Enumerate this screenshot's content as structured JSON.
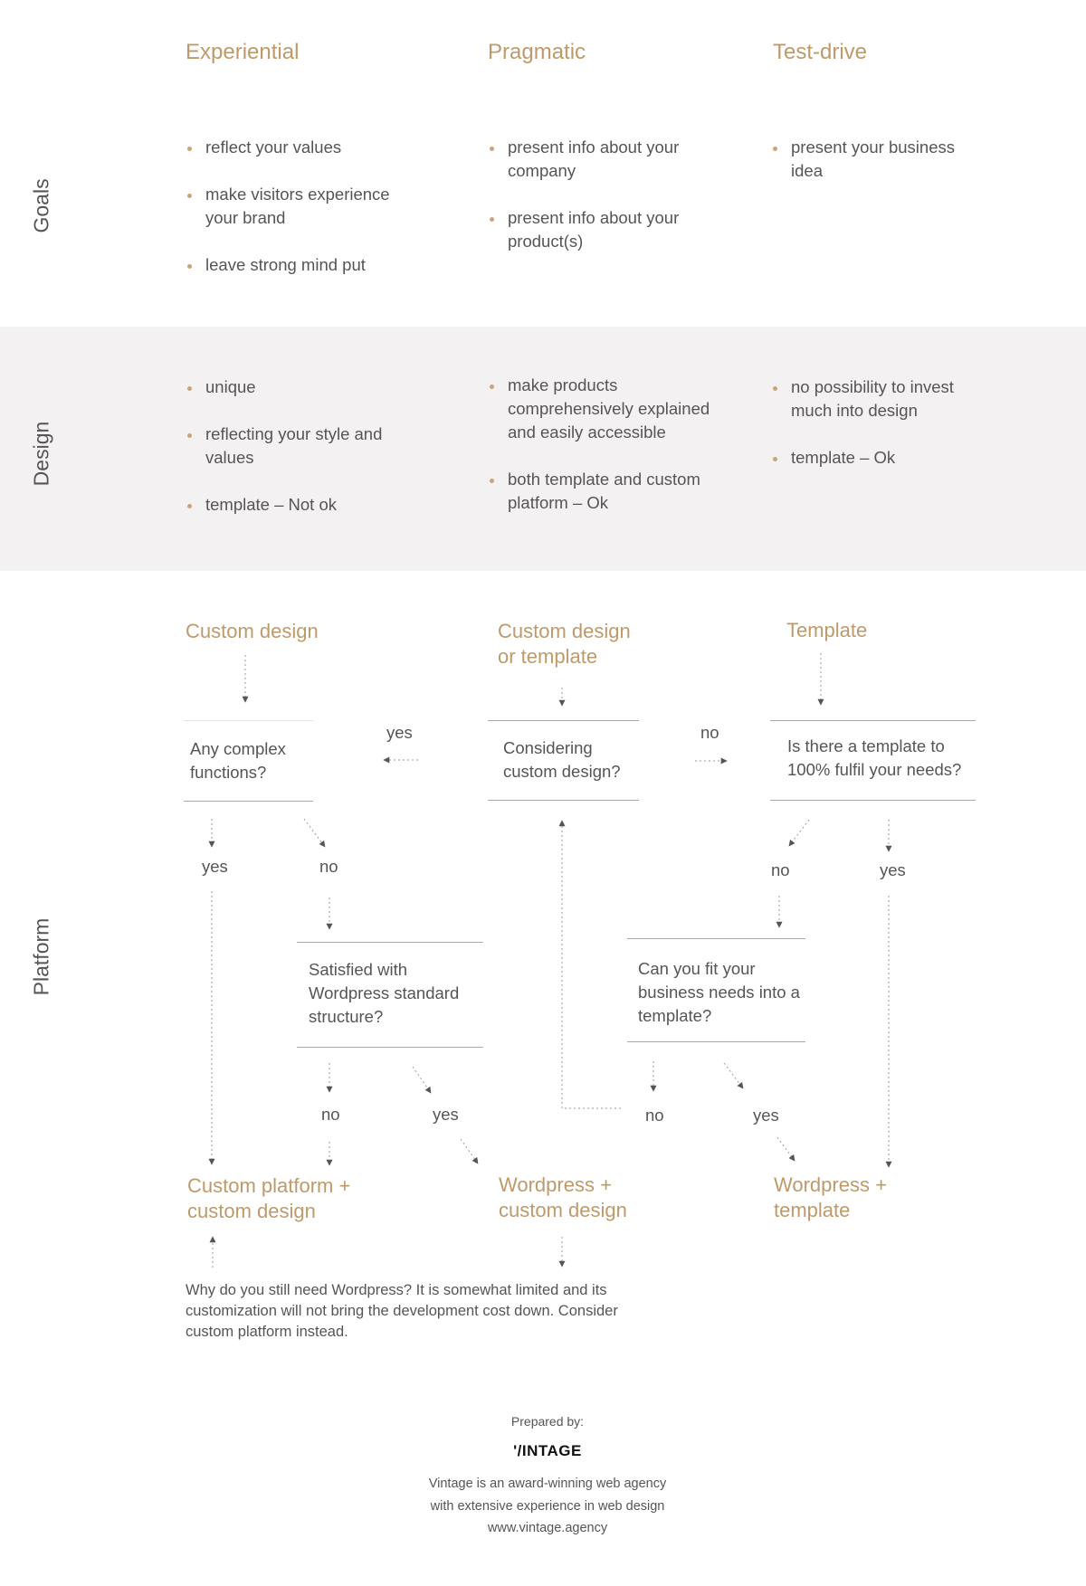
{
  "columns": [
    {
      "title": "Experiential"
    },
    {
      "title": "Pragmatic"
    },
    {
      "title": "Test-drive"
    }
  ],
  "rows": {
    "goals": {
      "label": "Goals",
      "experiential": [
        "reflect your values",
        "make visitors experience your brand",
        "leave strong mind put"
      ],
      "pragmatic": [
        "present info about your company",
        "present info about your product(s)"
      ],
      "test_drive": [
        "present your business idea"
      ]
    },
    "design": {
      "label": "Design",
      "experiential": [
        "unique",
        "reflecting your style and values",
        "template – Not ok"
      ],
      "pragmatic": [
        "make products comprehensively explained and easily accessible",
        "both template and custom platform – Ok"
      ],
      "test_drive": [
        "no possibility to invest much into design",
        "template – Ok"
      ]
    },
    "platform": {
      "label": "Platform"
    }
  },
  "flow": {
    "starts": {
      "custom_design": "Custom design",
      "custom_or_template": "Custom design or template",
      "template": "Template"
    },
    "questions": {
      "complex_functions": "Any complex functions?",
      "considering_custom": "Considering custom design?",
      "template_fulfil": "Is there a template to 100% fulfil your needs?",
      "satisfied_wordpress": "Satisfied with Wordpress standard structure?",
      "fit_template": "Can you fit your business needs into a template?"
    },
    "labels": {
      "yes": "yes",
      "no": "no"
    },
    "outcomes": {
      "custom_platform": "Custom platform + custom design",
      "wordpress_custom": "Wordpress + custom design",
      "wordpress_template": "Wordpress + template"
    },
    "note": "Why do you still need Wordpress? It is somewhat limited and its customization will not bring the development cost down. Consider custom platform instead."
  },
  "footer": {
    "prepared_by": "Prepared by:",
    "logo": "'/INTAGE",
    "description_line1": "Vintage is an award-winning web agency",
    "description_line2": "with extensive experience in web design",
    "website": "www.vintage.agency"
  },
  "colors": {
    "accent": "#be9a6a",
    "text": "#555555",
    "band": "#f3f1f2",
    "rule": "#a9a9a9"
  }
}
